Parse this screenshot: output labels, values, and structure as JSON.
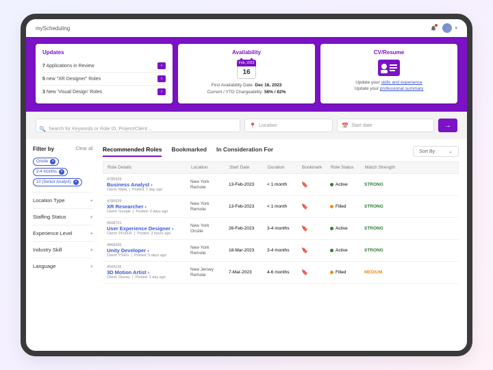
{
  "brand": "myScheduling",
  "hero": {
    "updates": {
      "title": "Updates",
      "items": [
        {
          "count": "7",
          "text": " Applications in Review"
        },
        {
          "count": "5",
          "text": " new \"XR Designer\" Roles"
        },
        {
          "count": "3",
          "text": " New 'Visual Design' Roles"
        }
      ]
    },
    "availability": {
      "title": "Availability",
      "cal_month": "Feb, 2023",
      "cal_day": "16",
      "line1_label": "First Availability Date: ",
      "line1_value": "Dec 16, 2023",
      "line2_label": "Current / YTD Chargeability: ",
      "line2_value": "56% / 82%"
    },
    "resume": {
      "title": "CV/Resume",
      "line1_pre": "Update your ",
      "line1_link": "skills and experience",
      "line2_pre": "Update your ",
      "line2_link": "professional summary"
    }
  },
  "search": {
    "placeholder": "Search for Keywords or Role ID, Project/Client ...",
    "loc_placeholder": "Location",
    "date_placeholder": "Start date"
  },
  "filters": {
    "title": "Filter by",
    "clear": "Clear all",
    "chips": [
      "Onsite",
      "3-4 months",
      "10 (Senior Analyst)"
    ],
    "groups": [
      "Location Type",
      "Staffing Status",
      "Experience Level",
      "Industry Skill",
      "Language"
    ]
  },
  "tabs": [
    "Recommended Roles",
    "Bookmarked",
    "In Consideration For"
  ],
  "sort_label": "Sort By",
  "columns": [
    "Role Details",
    "Location",
    "Start Date",
    "Duration",
    "Bookmark",
    "Role Status",
    "Match Strength"
  ],
  "rows": [
    {
      "id": "4785939",
      "title": "Business Analyst",
      "client": "Client: Meta",
      "posted": "Posted: 1 day ago",
      "loc1": "New York",
      "loc2": "Remote",
      "start": "13-Feb-2023",
      "dur": "< 1 month",
      "status": "Active",
      "status_color": "green",
      "strength": "STRONG",
      "sclass": "strong"
    },
    {
      "id": "4785939",
      "title": "XR Researcher",
      "client": "Client: Google",
      "posted": "Posted: 3 days ago",
      "loc1": "New York",
      "loc2": "Remote",
      "start": "13-Feb-2023",
      "dur": "< 1 month",
      "status": "Filled",
      "status_color": "orange",
      "strength": "STRONG",
      "sclass": "strong"
    },
    {
      "id": "4568721",
      "title": "User Experience Designer",
      "client": "Client: PFIZER",
      "posted": "Posted: 2 hours ago",
      "loc1": "New York",
      "loc2": "Onsite",
      "start": "26-Feb-2023",
      "dur": "3-4 months",
      "status": "Active",
      "status_color": "green",
      "strength": "STRONG",
      "sclass": "strong"
    },
    {
      "id": "4868395",
      "title": "Unity Developer",
      "client": "Client: PSEG",
      "posted": "Posted: 5 days ago",
      "loc1": "New York",
      "loc2": "Remote",
      "start": "18-Mar-2023",
      "dur": "3-4 months",
      "status": "Active",
      "status_color": "green",
      "strength": "STRONG",
      "sclass": "strong"
    },
    {
      "id": "4584136",
      "title": "3D Motion Artist",
      "client": "Client: Disney",
      "posted": "Posted: 1 day ago",
      "loc1": "New Jersey",
      "loc2": "Remote",
      "start": "7-Mar-2023",
      "dur": "4-6 months",
      "status": "Filled",
      "status_color": "orange",
      "strength": "MEDIUM",
      "sclass": "medium"
    }
  ]
}
